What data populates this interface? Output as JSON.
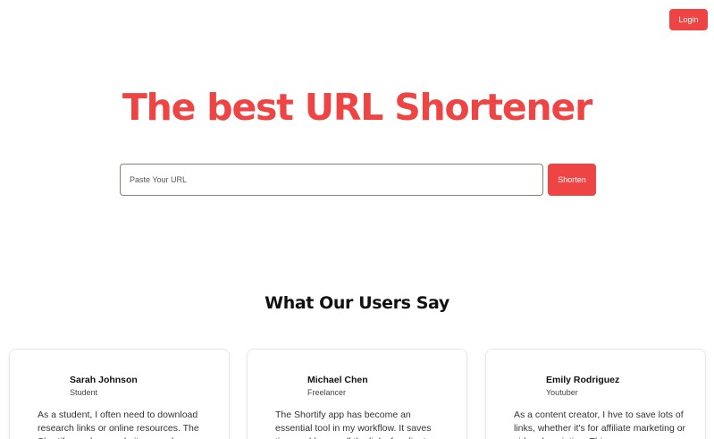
{
  "header": {
    "login_label": "Login"
  },
  "hero": {
    "title": "The best URL Shortener",
    "url_placeholder": "Paste Your URL",
    "shorten_label": "Shorten"
  },
  "testimonials": {
    "title": "What Our Users Say",
    "items": [
      {
        "name": "Sarah Johnson",
        "role": "Student",
        "text": "As a student, I often need to download research links or online resources. The Shortify app has made it so much..."
      },
      {
        "name": "Michael Chen",
        "role": "Freelancer",
        "text": "The Shortify app has become an essential tool in my workflow. It saves time and keeps all the links for clients..."
      },
      {
        "name": "Emily Rodriguez",
        "role": "Youtuber",
        "text": "As a content creator, I hve to save lots of links, whether it's for affiliate marketing or video description. This..."
      }
    ]
  },
  "colors": {
    "accent": "#ef4444",
    "input_border": "#8a7f77",
    "card_border": "#e5e7eb"
  }
}
